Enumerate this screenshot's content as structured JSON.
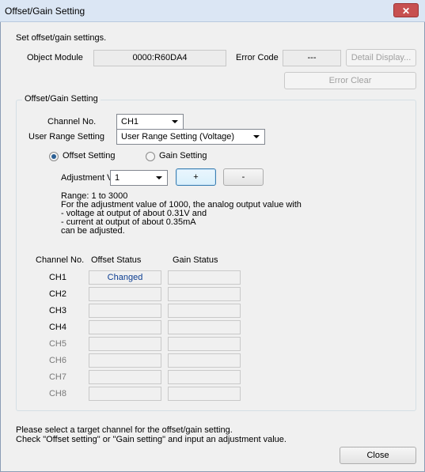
{
  "window": {
    "title": "Offset/Gain Setting",
    "close_glyph": "✕"
  },
  "header": {
    "instruction": "Set offset/gain settings.",
    "object_module_label": "Object Module",
    "object_module_value": "0000:R60DA4",
    "error_code_label": "Error Code",
    "error_code_value": "---",
    "detail_display_label": "Detail Display...",
    "error_clear_label": "Error Clear"
  },
  "group": {
    "title": "Offset/Gain Setting",
    "channel_no_label": "Channel No.",
    "channel_no_value": "CH1",
    "user_range_label": "User Range Setting",
    "user_range_value": "User Range Setting (Voltage)",
    "offset_setting_label": "Offset Setting",
    "gain_setting_label": "Gain Setting",
    "selected_mode": "offset",
    "adjustment_label": "Adjustment V",
    "adjustment_value": "1",
    "plus_label": "+",
    "minus_label": "-",
    "range_lines": [
      "Range: 1 to 3000",
      "For the adjustment value of 1000, the analog output value with",
      "- voltage at output of about 0.31V and",
      "- current at output of about 0.35mA",
      "can be adjusted."
    ],
    "table": {
      "headers": [
        "Channel No.",
        "Offset Status",
        "Gain Status"
      ],
      "rows": [
        {
          "channel": "CH1",
          "offset": "Changed",
          "gain": ""
        },
        {
          "channel": "CH2",
          "offset": "",
          "gain": ""
        },
        {
          "channel": "CH3",
          "offset": "",
          "gain": ""
        },
        {
          "channel": "CH4",
          "offset": "",
          "gain": ""
        },
        {
          "channel": "CH5",
          "offset": "",
          "gain": ""
        },
        {
          "channel": "CH6",
          "offset": "",
          "gain": ""
        },
        {
          "channel": "CH7",
          "offset": "",
          "gain": ""
        },
        {
          "channel": "CH8",
          "offset": "",
          "gain": ""
        }
      ]
    }
  },
  "footer": {
    "message_lines": [
      "Please select a target channel for the offset/gain setting.",
      "Check \"Offset setting\" or \"Gain setting\" and input an adjustment value."
    ],
    "close_label": "Close"
  }
}
